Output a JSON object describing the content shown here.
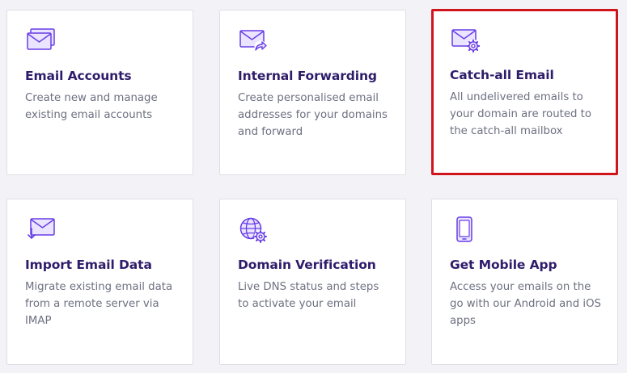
{
  "cards": [
    {
      "title": "Email Accounts",
      "description": "Create new and manage existing email accounts",
      "icon": "email-accounts-icon"
    },
    {
      "title": "Internal Forwarding",
      "description": "Create personalised email addresses for your domains and forward",
      "icon": "email-forward-icon"
    },
    {
      "title": "Catch-all Email",
      "description": "All undelivered emails to your domain are routed to the catch-all mailbox",
      "icon": "email-settings-icon",
      "highlighted": true
    },
    {
      "title": "Import Email Data",
      "description": "Migrate existing email data from a remote server via IMAP",
      "icon": "email-import-icon"
    },
    {
      "title": "Domain Verification",
      "description": "Live DNS status and steps to activate your email",
      "icon": "globe-settings-icon"
    },
    {
      "title": "Get Mobile App",
      "description": "Access your emails on the go with our Android and iOS apps",
      "icon": "mobile-phone-icon"
    }
  ],
  "colors": {
    "page_background": "#f3f3f7",
    "card_background": "#ffffff",
    "title": "#2f1c6a",
    "description": "#6d7081",
    "icon_stroke": "#673de6",
    "icon_fill": "#ebe4ff",
    "highlight_border": "#d0141c"
  }
}
